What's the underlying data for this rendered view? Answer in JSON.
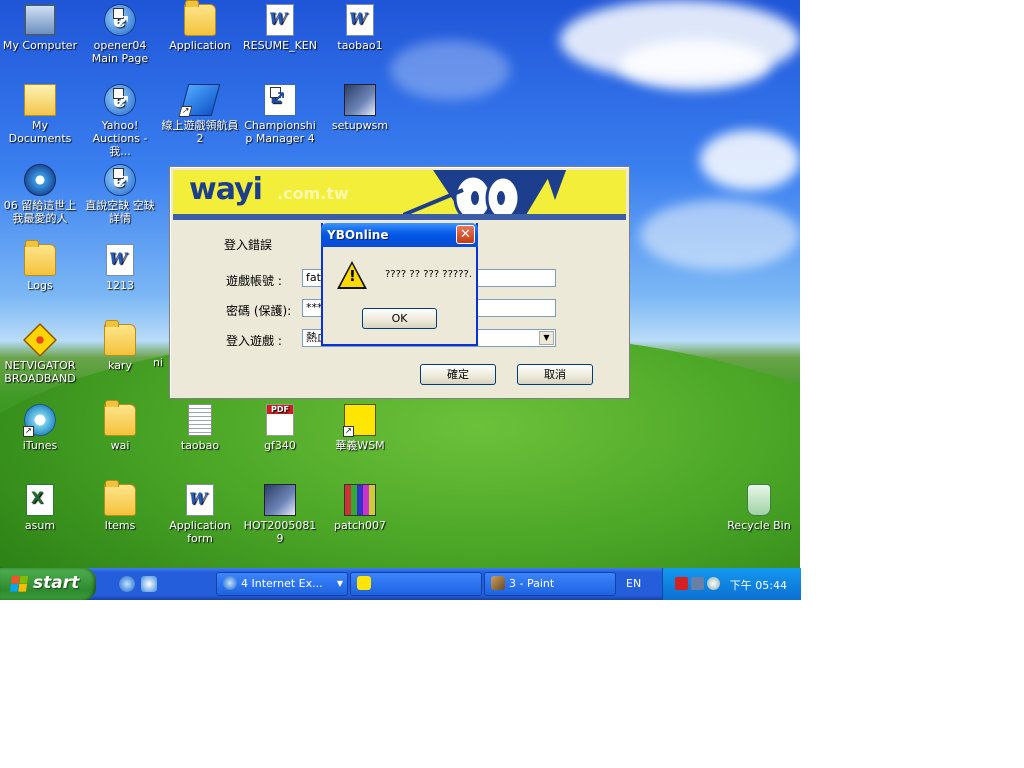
{
  "desktop": {
    "icons": [
      {
        "label": "My Computer"
      },
      {
        "label": "opener04 Main Page"
      },
      {
        "label": "Application"
      },
      {
        "label": "RESUME_KEN"
      },
      {
        "label": "taobao1"
      },
      {
        "label": "My Documents"
      },
      {
        "label": "Yahoo! Auctions - 我..."
      },
      {
        "label": "線上遊戲領航員2"
      },
      {
        "label": "Championship Manager 4"
      },
      {
        "label": "setupwsm"
      },
      {
        "label": "06 留給這世上我最愛的人"
      },
      {
        "label": "直說空缺 空缺詳情"
      },
      {
        "label": "Logs"
      },
      {
        "label": "1213"
      },
      {
        "label": "NETVIGATOR BROADBAND"
      },
      {
        "label": "kary"
      },
      {
        "label": "ni"
      },
      {
        "label": "iTunes"
      },
      {
        "label": "wai"
      },
      {
        "label": "taobao"
      },
      {
        "label": "gf340"
      },
      {
        "label": "華義WSM"
      },
      {
        "label": "asum"
      },
      {
        "label": "Items"
      },
      {
        "label": "Application form"
      },
      {
        "label": "HOT20050819"
      },
      {
        "label": "patch007"
      },
      {
        "label": "Recycle Bin"
      }
    ]
  },
  "login_window": {
    "brand": "wayi",
    "domain": ".com.tw",
    "status_text": "登入錯誤",
    "account_label": "遊戲帳號 :",
    "account_value": "fatb",
    "password_label": "密碼 (保護):",
    "password_value": "***",
    "game_label": "登入遊戲 :",
    "game_value": "熱血",
    "confirm_button": "確定",
    "cancel_button": "取消"
  },
  "message_box": {
    "title": "YBOnline",
    "message": "???? ?? ??? ?????.",
    "ok_button": "OK",
    "close_glyph": "✕"
  },
  "taskbar": {
    "start_label": "start",
    "tasks": [
      {
        "label": "4 Internet Ex...",
        "has_dropdown": true
      },
      {
        "label": ""
      },
      {
        "label": "3 - Paint"
      }
    ],
    "language": "EN",
    "clock": "下午 05:44"
  }
}
